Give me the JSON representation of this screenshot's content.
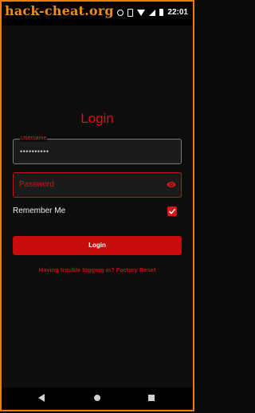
{
  "watermark": "hack-cheat.org",
  "status_bar": {
    "time": "22:01",
    "icons": [
      "alarm-icon",
      "vibrate-icon",
      "wifi-icon",
      "signal-icon",
      "battery-icon"
    ]
  },
  "login": {
    "title": "Login",
    "username": {
      "label": "Username",
      "value": "••••••••••"
    },
    "password": {
      "placeholder": "Password",
      "toggle_icon": "eye-icon"
    },
    "remember_me": {
      "label": "Remember Me",
      "checked": true
    },
    "submit_label": "Login",
    "trouble_text": "Having trouble logging in? Factory Reset"
  },
  "nav_bar": {
    "icons": [
      "back-icon",
      "home-icon",
      "recents-icon"
    ]
  },
  "colors": {
    "accent": "#c80b0b",
    "background": "#0d0d0d",
    "watermark": "#f08a1a"
  }
}
